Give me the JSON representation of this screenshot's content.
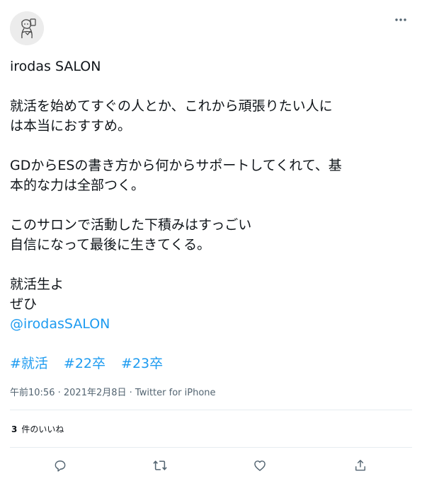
{
  "tweet": {
    "lines": [
      "irodas SALON",
      "",
      "就活を始めてすぐの人とか、これから頑張りたい人に",
      "は本当におすすめ。",
      "",
      "GDからESの書き方から何からサポートしてくれて、基",
      "本的な力は全部つく。",
      "",
      "このサロンで活動した下積みはすっごい",
      "自信になって最後に生きてくる。",
      "",
      "就活生よ",
      "ぜひ"
    ],
    "mention": "@irodasSALON",
    "hashtags": [
      "#就活",
      "#22卒",
      "#23卒"
    ],
    "time": "午前10:56",
    "date": "2021年2月8日",
    "separator": " · ",
    "source": "Twitter for iPhone"
  },
  "likes": {
    "count": "3",
    "label": "件のいいね"
  },
  "icons": {
    "more": "more-horizontal-icon",
    "reply": "reply-icon",
    "retweet": "retweet-icon",
    "like": "like-icon",
    "share": "share-icon"
  },
  "colors": {
    "link": "#1d9bf0",
    "muted": "#536471",
    "text": "#0f1419",
    "divider": "#e6ecf0"
  }
}
